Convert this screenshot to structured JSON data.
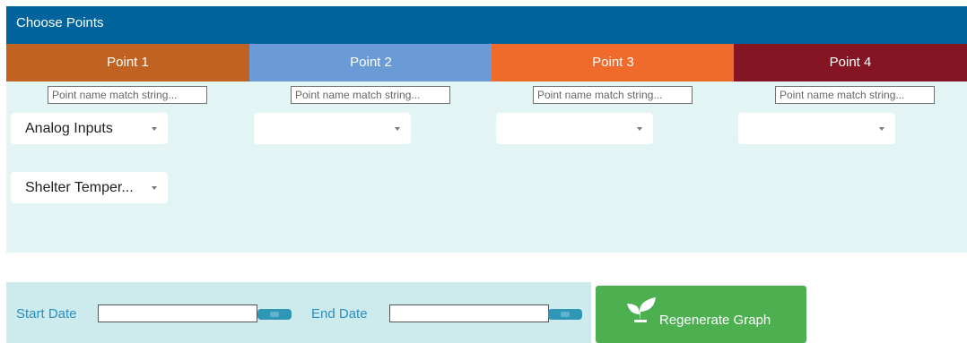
{
  "header": {
    "title": "Choose Points"
  },
  "points": [
    {
      "label": "Point 1",
      "color": "#bf6222",
      "placeholder": "Point name match string...",
      "category": "Analog Inputs",
      "point": "Shelter Temper..."
    },
    {
      "label": "Point 2",
      "color": "#6a9bd6",
      "placeholder": "Point name match string...",
      "category": ""
    },
    {
      "label": "Point 3",
      "color": "#f06b2b",
      "placeholder": "Point name match string...",
      "category": ""
    },
    {
      "label": "Point 4",
      "color": "#861524",
      "placeholder": "Point name match string...",
      "category": ""
    }
  ],
  "dates": {
    "start_label": "Start Date",
    "end_label": "End Date"
  },
  "actions": {
    "regenerate_label": "Regenerate Graph"
  },
  "icons": {
    "calendar": "calendar-icon",
    "dropdown": "caret-down-icon",
    "regenerate": "plant-icon"
  }
}
